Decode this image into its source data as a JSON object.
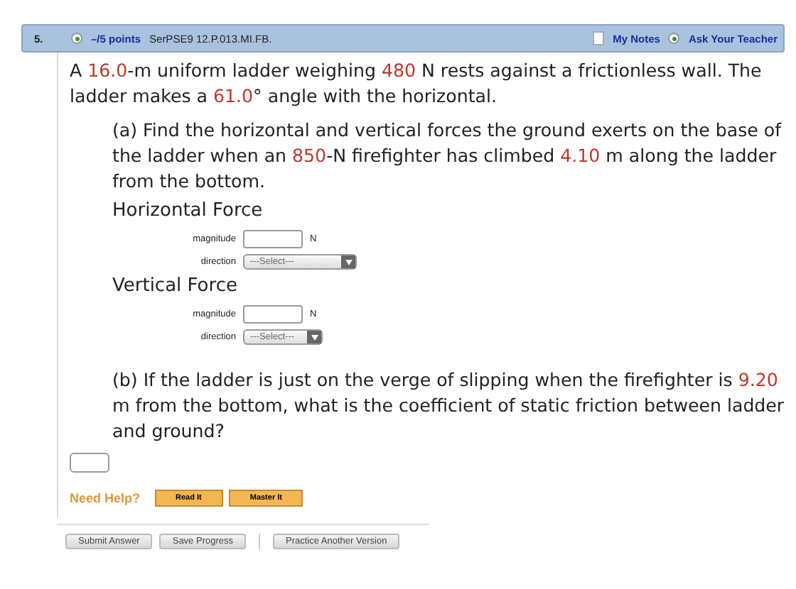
{
  "header": {
    "number": "5.",
    "points": "–/5 points",
    "code": "SerPSE9 12.P.013.MI.FB.",
    "notes": "My Notes",
    "ask": "Ask Your Teacher"
  },
  "intro": [
    {
      "text": "A ",
      "highlight": false
    },
    {
      "text": "16.0",
      "highlight": true
    },
    {
      "text": "-m uniform ladder weighing ",
      "highlight": false
    },
    {
      "text": "480",
      "highlight": true
    },
    {
      "text": " N rests against a frictionless wall. The ladder makes a ",
      "highlight": false
    },
    {
      "text": "61.0",
      "highlight": true
    },
    {
      "text": "° angle with the horizontal.",
      "highlight": false
    }
  ],
  "part_a": [
    {
      "text": "(a) Find the horizontal and vertical forces the ground exerts on the base of the ladder when an ",
      "highlight": false
    },
    {
      "text": "850",
      "highlight": true
    },
    {
      "text": "-N firefighter has climbed ",
      "highlight": false
    },
    {
      "text": "4.10",
      "highlight": true
    },
    {
      "text": " m along the ladder from the bottom.",
      "highlight": false
    }
  ],
  "forces": [
    {
      "title": "Horizontal Force",
      "magnitude_label": "magnitude",
      "unit": "N",
      "direction_label": "direction",
      "select": "---Select---"
    },
    {
      "title": "Vertical Force",
      "magnitude_label": "magnitude",
      "unit": "N",
      "direction_label": "direction",
      "select": "---Select---"
    }
  ],
  "part_b": [
    {
      "text": "(b) If the ladder is just on the verge of slipping when the firefighter is ",
      "highlight": false
    },
    {
      "text": "9.20",
      "highlight": true
    },
    {
      "text": " m from the bottom, what is the coefficient of static friction between ladder and ground?",
      "highlight": false
    }
  ],
  "help": {
    "label": "Need Help?",
    "buttons": [
      "Read It",
      "Master It"
    ]
  },
  "footer": {
    "buttons": [
      "Submit Answer",
      "Save Progress"
    ],
    "practice": "Practice Another Version"
  }
}
